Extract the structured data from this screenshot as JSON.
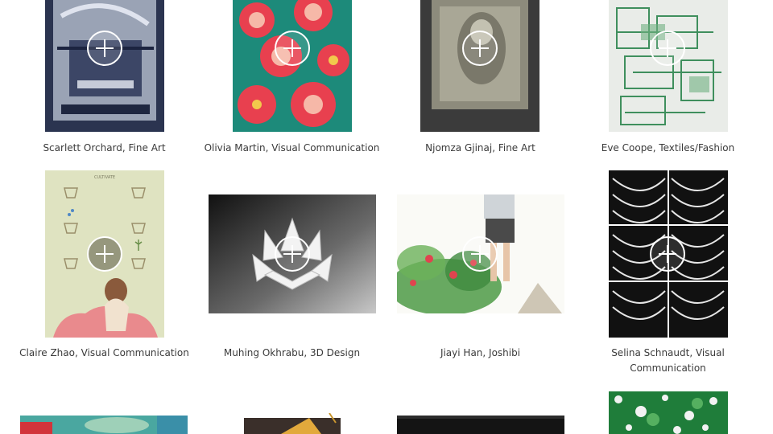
{
  "gallery": {
    "items": [
      {
        "caption": "Scarlett Orchard, Fine Art"
      },
      {
        "caption": "Olivia Martin, Visual Communication"
      },
      {
        "caption": "Njomza Gjinaj, Fine Art"
      },
      {
        "caption": "Eve Coope, Textiles/Fashion"
      },
      {
        "caption": "Claire Zhao, Visual Communication"
      },
      {
        "caption": "Muhing Okhrabu, 3D Design"
      },
      {
        "caption": "Jiayi Han, Joshibi"
      },
      {
        "caption": "Selina Schnaudt, Visual Communication"
      }
    ],
    "poster_text": "CULTIVATE",
    "open_icon": "plus-circle-icon"
  }
}
